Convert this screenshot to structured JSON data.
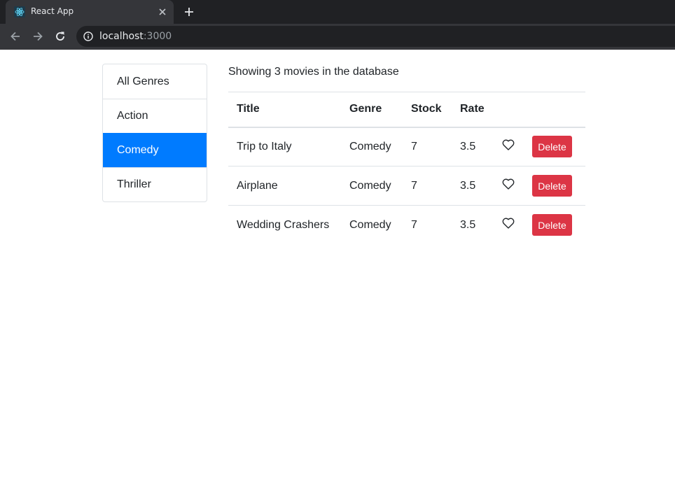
{
  "browser": {
    "tab_title": "React App",
    "url_host": "localhost",
    "url_port": ":3000"
  },
  "sidebar": {
    "genres": [
      {
        "label": "All Genres",
        "active": false
      },
      {
        "label": "Action",
        "active": false
      },
      {
        "label": "Comedy",
        "active": true
      },
      {
        "label": "Thriller",
        "active": false
      }
    ]
  },
  "main": {
    "summary": "Showing 3 movies in the database",
    "headers": {
      "title": "Title",
      "genre": "Genre",
      "stock": "Stock",
      "rate": "Rate"
    },
    "movies": [
      {
        "title": "Trip to Italy",
        "genre": "Comedy",
        "stock": "7",
        "rate": "3.5",
        "delete_label": "Delete"
      },
      {
        "title": "Airplane",
        "genre": "Comedy",
        "stock": "7",
        "rate": "3.5",
        "delete_label": "Delete"
      },
      {
        "title": "Wedding Crashers",
        "genre": "Comedy",
        "stock": "7",
        "rate": "3.5",
        "delete_label": "Delete"
      }
    ]
  },
  "colors": {
    "primary": "#007bff",
    "danger": "#dc3545"
  }
}
